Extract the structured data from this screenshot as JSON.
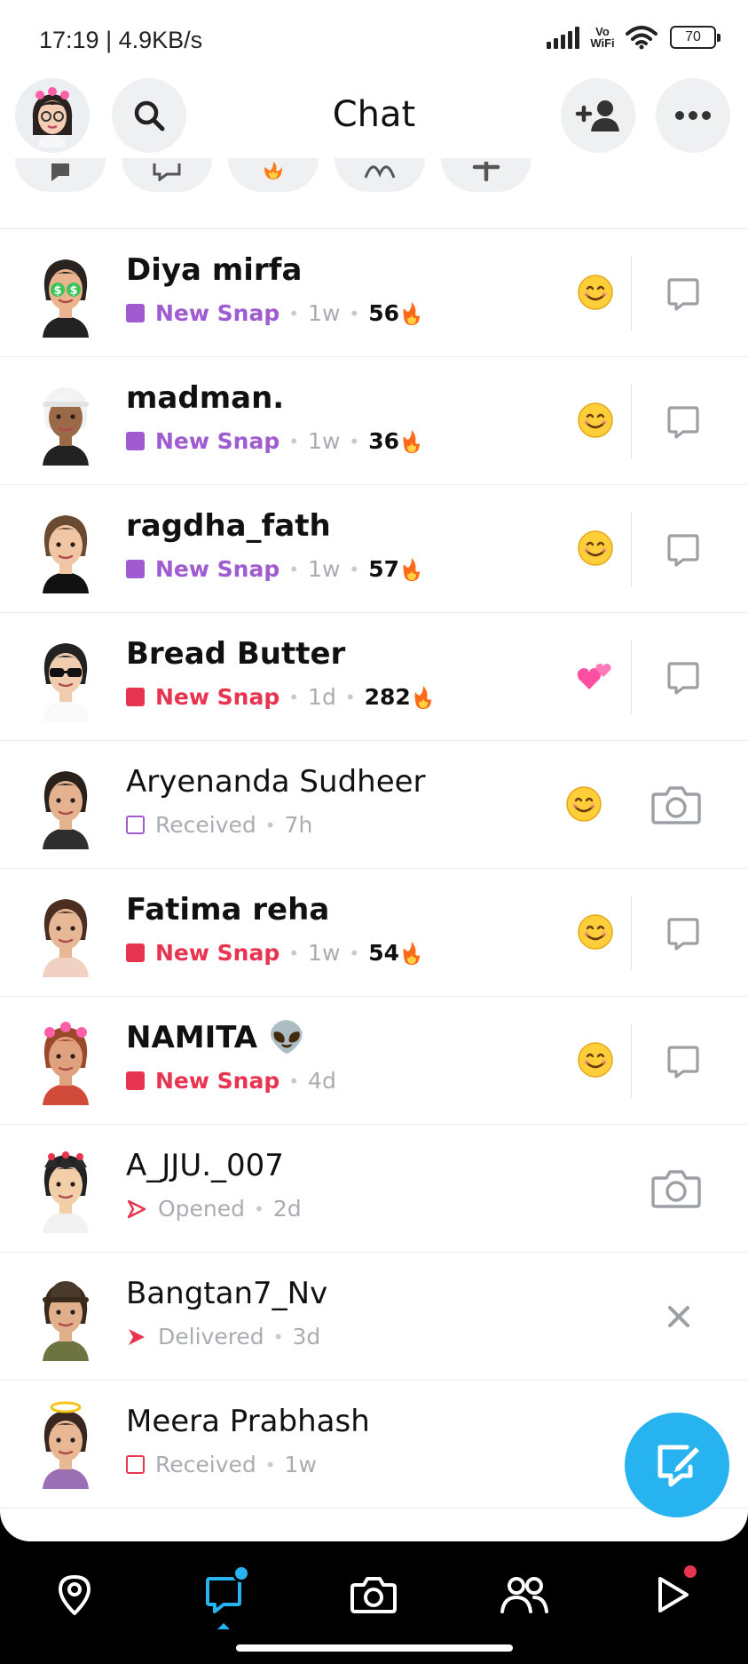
{
  "status_bar": {
    "time": "17:19 | 4.9KB/s",
    "vowifi_top": "Vo",
    "vowifi_bottom": "WiFi",
    "battery": "70"
  },
  "header": {
    "title": "Chat"
  },
  "filters": [
    {
      "icon": "chat-bubble-icon"
    },
    {
      "icon": "chats-icon"
    },
    {
      "icon": "fire-icon"
    },
    {
      "icon": "link-icon"
    },
    {
      "icon": "plus-icon"
    }
  ],
  "colors": {
    "accent": "#27b3f0",
    "purple_snap": "#a05bd1",
    "red_snap": "#e8354f",
    "icon_gray": "#9ca0a5"
  },
  "chats": [
    {
      "name": "Diya mirfa",
      "status": "New Snap",
      "time": "1w",
      "streak": "56",
      "status_kind": "purple",
      "emoji": "smile",
      "action": "chat"
    },
    {
      "name": "madman.",
      "status": "New Snap",
      "time": "1w",
      "streak": "36",
      "status_kind": "purple",
      "emoji": "smile",
      "action": "chat"
    },
    {
      "name": "ragdha_fath",
      "status": "New Snap",
      "time": "1w",
      "streak": "57",
      "status_kind": "purple",
      "emoji": "smile",
      "action": "chat"
    },
    {
      "name": "Bread Butter",
      "status": "New Snap",
      "time": "1d",
      "streak": "282",
      "status_kind": "red",
      "emoji": "hearts",
      "action": "chat"
    },
    {
      "name": "Aryenanda Sudheer",
      "status": "Received",
      "time": "7h",
      "streak": "",
      "status_kind": "received-purple",
      "emoji": "smile",
      "action": "camera"
    },
    {
      "name": "Fatima reha",
      "status": "New Snap",
      "time": "1w",
      "streak": "54",
      "status_kind": "red",
      "emoji": "smile",
      "action": "chat"
    },
    {
      "name": "NAMITA 👽",
      "status": "New Snap",
      "time": "4d",
      "streak": "",
      "status_kind": "red",
      "emoji": "smile",
      "action": "chat"
    },
    {
      "name": "A_JJU._007",
      "status": "Opened",
      "time": "2d",
      "streak": "",
      "status_kind": "opened",
      "emoji": "",
      "action": "camera"
    },
    {
      "name": "Bangtan7_Nv",
      "status": "Delivered",
      "time": "3d",
      "streak": "",
      "status_kind": "delivered",
      "emoji": "",
      "action": "close"
    },
    {
      "name": "Meera Prabhash",
      "status": "Received",
      "time": "1w",
      "streak": "",
      "status_kind": "received-red",
      "emoji": "",
      "action": ""
    }
  ],
  "nav": [
    {
      "icon": "map-pin-icon",
      "badge": ""
    },
    {
      "icon": "chat-icon",
      "badge": "#27b3f0"
    },
    {
      "icon": "camera-icon",
      "badge": ""
    },
    {
      "icon": "friends-icon",
      "badge": ""
    },
    {
      "icon": "play-icon",
      "badge": "#e8354f"
    }
  ]
}
